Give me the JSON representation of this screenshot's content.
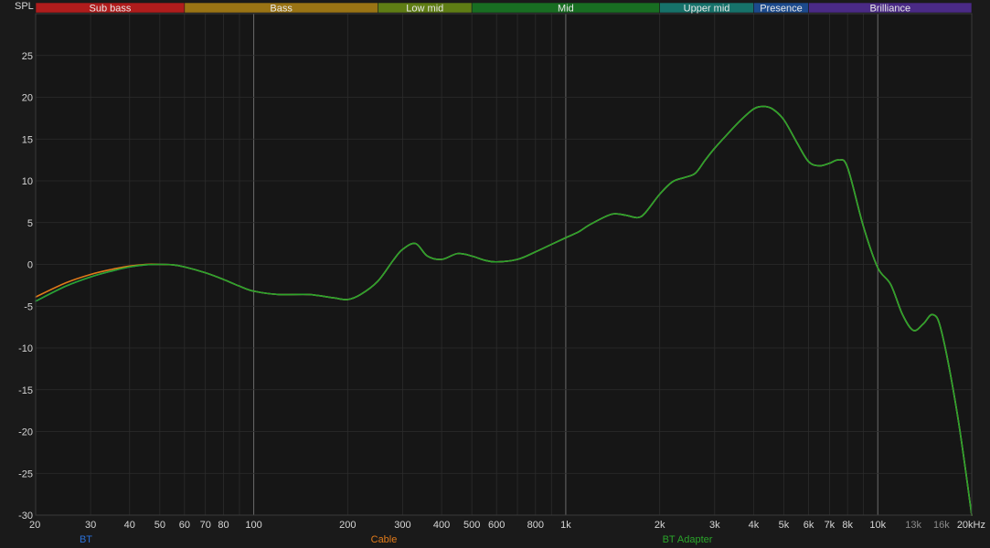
{
  "chart_data": {
    "type": "line",
    "ylabel": "SPL",
    "x_unit": "Hz",
    "x_scale": "log",
    "xlim": [
      20,
      20000
    ],
    "ylim": [
      -30,
      30
    ],
    "grid": true,
    "y_ticks": [
      25,
      20,
      15,
      10,
      5,
      0,
      -5,
      -10,
      -15,
      -20,
      -25,
      -30
    ],
    "x_ticks": [
      {
        "value": 20,
        "label": "20",
        "dim": false
      },
      {
        "value": 30,
        "label": "30",
        "dim": false
      },
      {
        "value": 40,
        "label": "40",
        "dim": false
      },
      {
        "value": 50,
        "label": "50",
        "dim": false
      },
      {
        "value": 60,
        "label": "60",
        "dim": false
      },
      {
        "value": 70,
        "label": "70",
        "dim": false
      },
      {
        "value": 80,
        "label": "80",
        "dim": false
      },
      {
        "value": 100,
        "label": "100",
        "dim": false
      },
      {
        "value": 200,
        "label": "200",
        "dim": false
      },
      {
        "value": 300,
        "label": "300",
        "dim": false
      },
      {
        "value": 400,
        "label": "400",
        "dim": false
      },
      {
        "value": 500,
        "label": "500",
        "dim": false
      },
      {
        "value": 600,
        "label": "600",
        "dim": false
      },
      {
        "value": 800,
        "label": "800",
        "dim": false
      },
      {
        "value": 1000,
        "label": "1k",
        "dim": false
      },
      {
        "value": 2000,
        "label": "2k",
        "dim": false
      },
      {
        "value": 3000,
        "label": "3k",
        "dim": false
      },
      {
        "value": 4000,
        "label": "4k",
        "dim": false
      },
      {
        "value": 5000,
        "label": "5k",
        "dim": false
      },
      {
        "value": 6000,
        "label": "6k",
        "dim": false
      },
      {
        "value": 7000,
        "label": "7k",
        "dim": false
      },
      {
        "value": 8000,
        "label": "8k",
        "dim": false
      },
      {
        "value": 10000,
        "label": "10k",
        "dim": false
      },
      {
        "value": 13000,
        "label": "13k",
        "dim": true
      },
      {
        "value": 16000,
        "label": "16k",
        "dim": true
      },
      {
        "value": 20000,
        "label": "20kHz",
        "dim": false
      }
    ],
    "bands": [
      {
        "name": "Sub bass",
        "from": 20,
        "to": 60,
        "color": "#b01c1c"
      },
      {
        "name": "Bass",
        "from": 60,
        "to": 250,
        "color": "#9a7414"
      },
      {
        "name": "Low mid",
        "from": 250,
        "to": 500,
        "color": "#5f7d14"
      },
      {
        "name": "Mid",
        "from": 500,
        "to": 2000,
        "color": "#186e22"
      },
      {
        "name": "Upper mid",
        "from": 2000,
        "to": 4000,
        "color": "#16726a"
      },
      {
        "name": "Presence",
        "from": 4000,
        "to": 6000,
        "color": "#1c4a8c"
      },
      {
        "name": "Brilliance",
        "from": 6000,
        "to": 20000,
        "color": "#4a2a86"
      }
    ],
    "series": [
      {
        "name": "BT",
        "color": "#2a6fd6",
        "x": [
          20,
          25,
          30,
          35,
          40,
          45,
          50,
          55,
          60,
          70,
          80,
          90,
          100,
          120,
          150,
          180,
          200,
          220,
          250,
          280,
          300,
          330,
          360,
          400,
          450,
          500,
          550,
          600,
          700,
          800,
          900,
          1000,
          1100,
          1200,
          1400,
          1550,
          1700,
          1800,
          2000,
          2200,
          2400,
          2600,
          2800,
          3000,
          3300,
          3600,
          4000,
          4300,
          4600,
          5000,
          5500,
          6000,
          6500,
          7000,
          7500,
          8000,
          9000,
          10000,
          11000,
          12000,
          13000,
          14000,
          15000,
          16000,
          18000,
          20000
        ],
        "y": [
          -4.4,
          -2.6,
          -1.5,
          -0.8,
          -0.3,
          -0.05,
          0.0,
          -0.05,
          -0.3,
          -1.0,
          -1.8,
          -2.6,
          -3.2,
          -3.6,
          -3.6,
          -4.0,
          -4.2,
          -3.6,
          -2.0,
          0.5,
          1.8,
          2.5,
          1.0,
          0.6,
          1.3,
          1.0,
          0.5,
          0.3,
          0.6,
          1.5,
          2.4,
          3.2,
          3.9,
          4.8,
          6.0,
          5.9,
          5.6,
          6.2,
          8.4,
          9.9,
          10.4,
          10.9,
          12.5,
          13.9,
          15.6,
          17.1,
          18.6,
          18.9,
          18.6,
          17.3,
          14.6,
          12.3,
          11.8,
          12.1,
          12.5,
          11.6,
          4.5,
          -0.4,
          -2.4,
          -6.0,
          -7.9,
          -7.1,
          -6.0,
          -8.0,
          -18.0,
          -30.0
        ]
      },
      {
        "name": "Cable",
        "color": "#e07a1a",
        "x": [
          20,
          25,
          30,
          35,
          40,
          45,
          50,
          55,
          60,
          70,
          80,
          90,
          100,
          120,
          150,
          180,
          200,
          220,
          250,
          280,
          300,
          330,
          360,
          400,
          450,
          500,
          550,
          600,
          700,
          800,
          900,
          1000,
          1100,
          1200,
          1400,
          1550,
          1700,
          1800,
          2000,
          2200,
          2400,
          2600,
          2800,
          3000,
          3300,
          3600,
          4000,
          4300,
          4600,
          5000,
          5500,
          6000,
          6500,
          7000,
          7500,
          8000,
          9000,
          10000,
          11000,
          12000,
          13000,
          14000,
          15000,
          16000,
          18000,
          20000
        ],
        "y": [
          -3.9,
          -2.2,
          -1.2,
          -0.6,
          -0.2,
          0.0,
          0.0,
          -0.05,
          -0.3,
          -1.0,
          -1.8,
          -2.6,
          -3.2,
          -3.6,
          -3.6,
          -4.0,
          -4.2,
          -3.6,
          -2.0,
          0.5,
          1.8,
          2.5,
          1.0,
          0.6,
          1.3,
          1.0,
          0.5,
          0.3,
          0.6,
          1.5,
          2.4,
          3.2,
          3.9,
          4.8,
          6.0,
          5.9,
          5.6,
          6.2,
          8.4,
          9.9,
          10.4,
          10.9,
          12.5,
          13.9,
          15.6,
          17.1,
          18.6,
          18.9,
          18.6,
          17.3,
          14.6,
          12.3,
          11.8,
          12.1,
          12.5,
          11.6,
          4.5,
          -0.4,
          -2.4,
          -6.0,
          -7.9,
          -7.1,
          -6.0,
          -8.0,
          -18.0,
          -30.0
        ]
      },
      {
        "name": "BT Adapter",
        "color": "#2aa52a",
        "x": [
          20,
          25,
          30,
          35,
          40,
          45,
          50,
          55,
          60,
          70,
          80,
          90,
          100,
          120,
          150,
          180,
          200,
          220,
          250,
          280,
          300,
          330,
          360,
          400,
          450,
          500,
          550,
          600,
          700,
          800,
          900,
          1000,
          1100,
          1200,
          1400,
          1550,
          1700,
          1800,
          2000,
          2200,
          2400,
          2600,
          2800,
          3000,
          3300,
          3600,
          4000,
          4300,
          4600,
          5000,
          5500,
          6000,
          6500,
          7000,
          7500,
          8000,
          9000,
          10000,
          11000,
          12000,
          13000,
          14000,
          15000,
          16000,
          18000,
          20000
        ],
        "y": [
          -4.4,
          -2.6,
          -1.5,
          -0.8,
          -0.3,
          -0.05,
          0.0,
          -0.05,
          -0.3,
          -1.0,
          -1.8,
          -2.6,
          -3.2,
          -3.6,
          -3.6,
          -4.0,
          -4.2,
          -3.6,
          -2.0,
          0.5,
          1.8,
          2.5,
          1.0,
          0.6,
          1.3,
          1.0,
          0.5,
          0.3,
          0.6,
          1.5,
          2.4,
          3.2,
          3.9,
          4.8,
          6.0,
          5.9,
          5.6,
          6.2,
          8.4,
          9.9,
          10.4,
          10.9,
          12.5,
          13.9,
          15.6,
          17.1,
          18.6,
          18.9,
          18.6,
          17.3,
          14.6,
          12.3,
          11.8,
          12.1,
          12.5,
          11.6,
          4.5,
          -0.4,
          -2.4,
          -6.0,
          -7.9,
          -7.1,
          -6.0,
          -8.0,
          -18.0,
          -30.0
        ]
      }
    ]
  }
}
